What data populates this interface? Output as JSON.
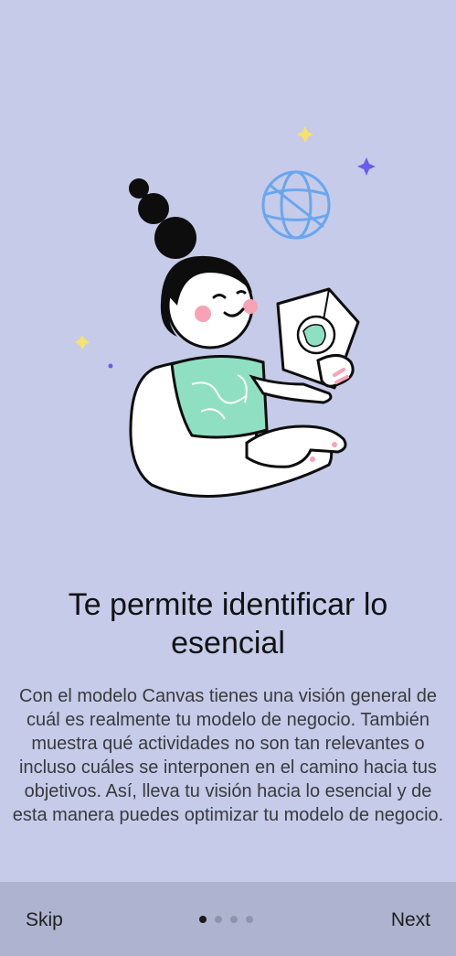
{
  "onboarding": {
    "title": "Te permite identificar lo esencial",
    "body": "Con el modelo Canvas tienes una visión general de cuál es realmente tu modelo de negocio. También muestra qué actividades no son tan relevantes o incluso cuáles se interponen en el camino hacia tus objetivos. Así, lleva tu visión hacia lo esencial y de esta manera puedes optimizar tu modelo de negocio.",
    "illustration_icon": "woman-reading-map-illustration"
  },
  "footer": {
    "skip_label": "Skip",
    "next_label": "Next",
    "page_count": 4,
    "current_page": 1
  },
  "colors": {
    "background": "#c5cbe8",
    "footer_background": "#aeb3cf",
    "shirt": "#8fe0c3",
    "globe": "#6aa6f0",
    "sparkle_yellow": "#f6e26a",
    "sparkle_purple": "#6b5cf0",
    "cheeks": "#f7a3b3"
  }
}
